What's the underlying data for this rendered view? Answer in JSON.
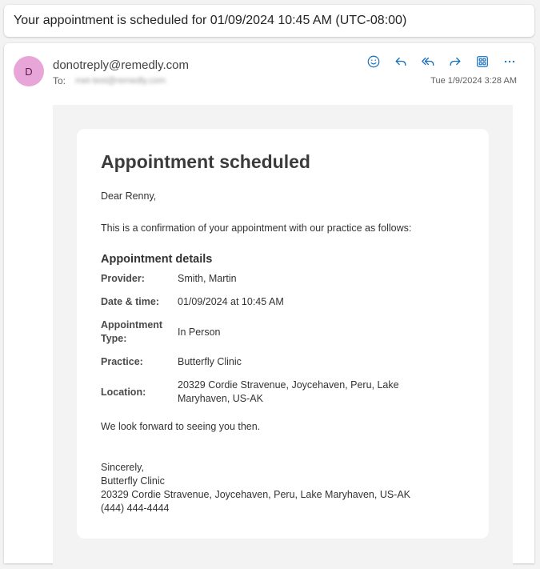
{
  "subject": "Your appointment is scheduled for 01/09/2024 10:45 AM (UTC-08:00)",
  "header": {
    "avatar_initial": "D",
    "avatar_color": "#e8a6d8",
    "sender": "donotreply@remedly.com",
    "to_label": "To:",
    "to_address": "met-test@remedly.com",
    "timestamp": "Tue 1/9/2024 3:28 AM",
    "actions": [
      "emoji-icon",
      "reply-icon",
      "reply-all-icon",
      "forward-icon",
      "apps-icon",
      "more-icon"
    ],
    "accent_color": "#0f6cbd"
  },
  "email": {
    "title": "Appointment scheduled",
    "greeting": "Dear Renny,",
    "intro": "This is a confirmation of your appointment with our practice as follows:",
    "details_heading": "Appointment details",
    "details": [
      {
        "label": "Provider:",
        "value": "Smith, Martin"
      },
      {
        "label": "Date & time:",
        "value": "01/09/2024 at 10:45 AM"
      },
      {
        "label": "Appointment Type:",
        "value": "In Person"
      },
      {
        "label": "Practice:",
        "value": "Butterfly Clinic"
      },
      {
        "label": "Location:",
        "value": "20329 Cordie Stravenue, Joycehaven, Peru, Lake Maryhaven, US-AK"
      }
    ],
    "closing": "We look forward to seeing you then.",
    "signature": {
      "sign_off": "Sincerely,",
      "practice": "Butterfly Clinic",
      "address": "20329 Cordie Stravenue, Joycehaven, Peru, Lake Maryhaven, US-AK",
      "phone": "(444) 444-4444"
    }
  }
}
